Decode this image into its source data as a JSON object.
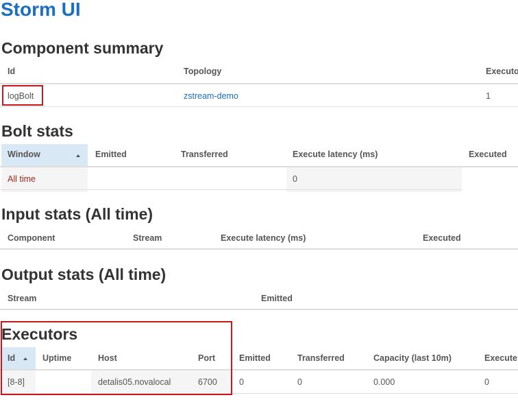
{
  "app": {
    "title": "Storm UI"
  },
  "component_summary": {
    "title": "Component summary",
    "headers": [
      "Id",
      "Topology",
      "Executo"
    ],
    "row": {
      "id": "logBolt",
      "topology": "zstream-demo",
      "executors": "1"
    }
  },
  "bolt_stats": {
    "title": "Bolt stats",
    "headers": [
      "Window",
      "Emitted",
      "Transferred",
      "Execute latency (ms)",
      "Executed"
    ],
    "row": {
      "window": "All time",
      "emitted": "",
      "transferred": "",
      "execute_latency": "0",
      "executed": ""
    }
  },
  "input_stats": {
    "title": "Input stats (All time)",
    "headers": [
      "Component",
      "Stream",
      "Execute latency (ms)",
      "Executed"
    ]
  },
  "output_stats": {
    "title": "Output stats (All time)",
    "headers": [
      "Stream",
      "Emitted"
    ]
  },
  "executors": {
    "title": "Executors",
    "headers": [
      "Id",
      "Uptime",
      "Host",
      "Port",
      "Emitted",
      "Transferred",
      "Capacity (last 10m)",
      "Execute"
    ],
    "row": {
      "id": "[8-8]",
      "uptime": "",
      "host": "detalis05.novalocal",
      "port": "6700",
      "emitted": "0",
      "transferred": "0",
      "capacity": "0.000",
      "executed": "0"
    }
  },
  "colors": {
    "title": "#1a6fc0",
    "link": "#1a6fc0",
    "highlight_box": "#c8171e",
    "sorted_header_bg": "#d9e8f5"
  },
  "icons": {
    "sort": "sort-ascending-icon"
  }
}
